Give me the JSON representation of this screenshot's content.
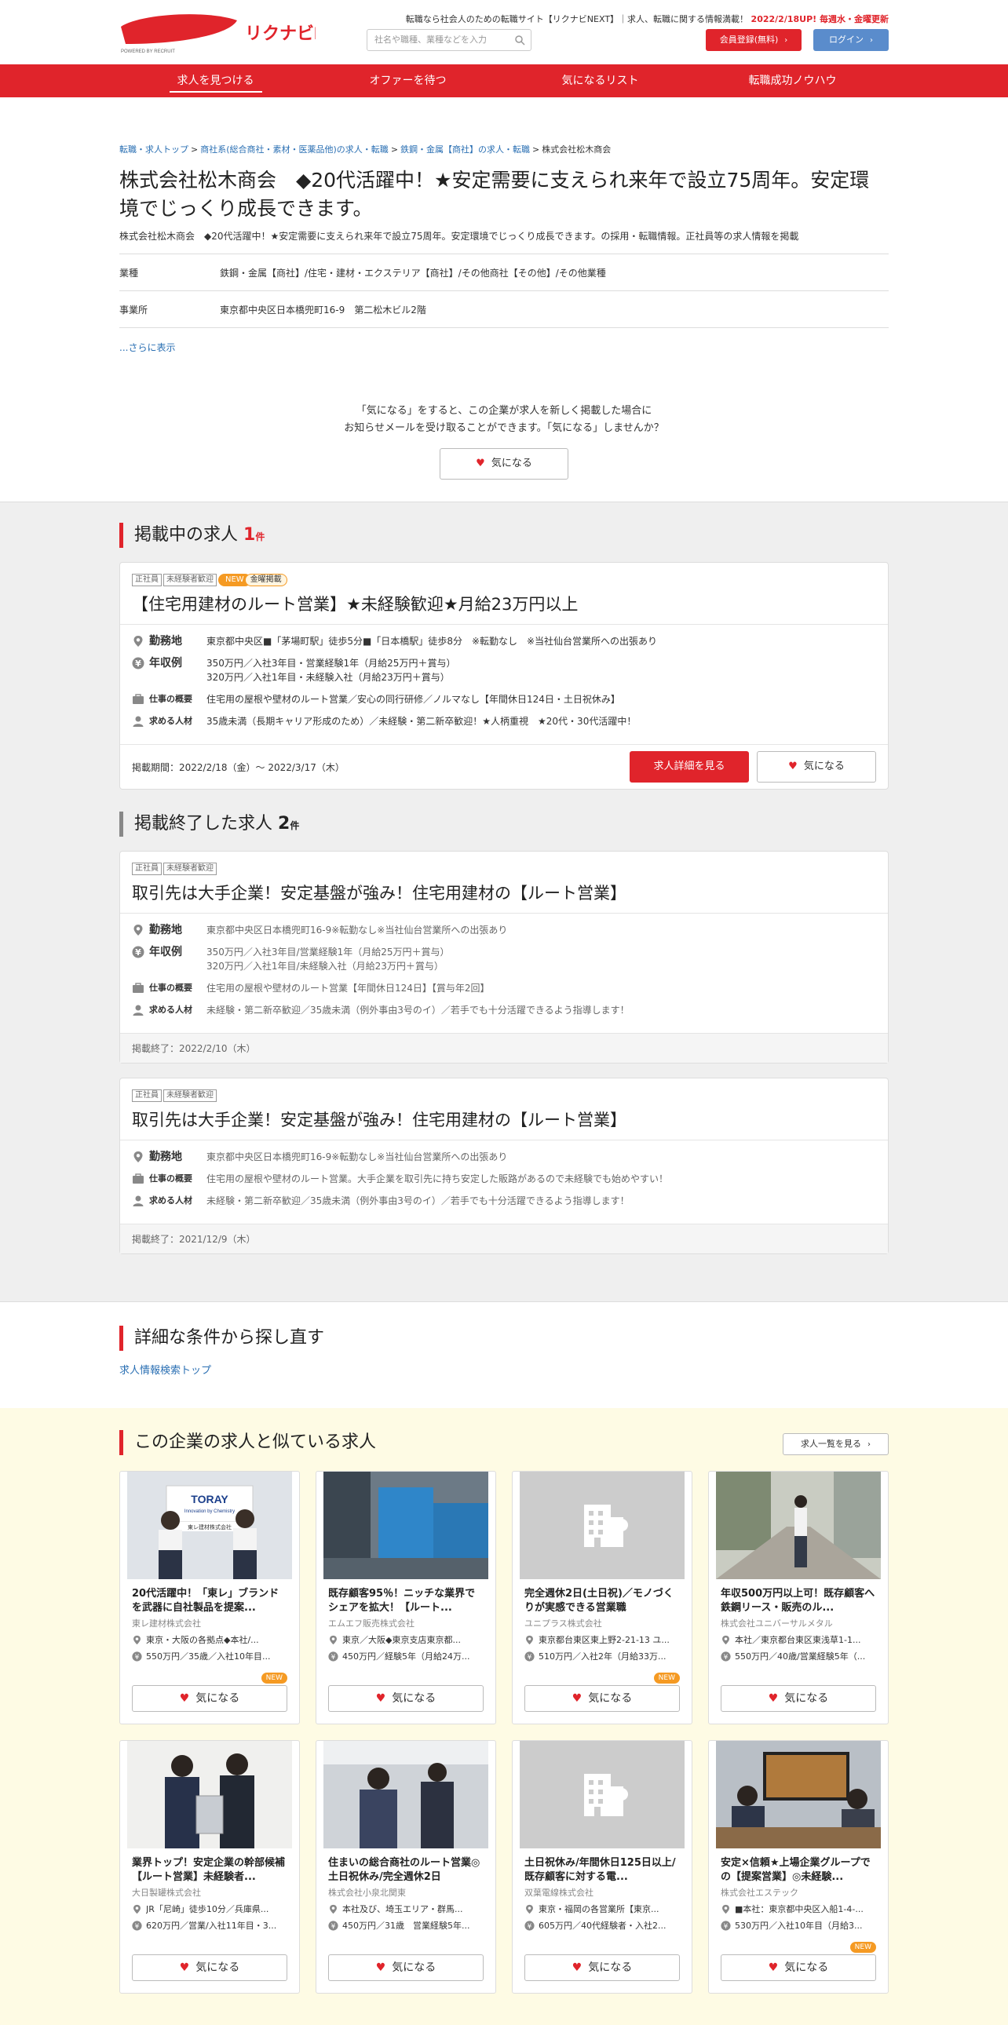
{
  "header": {
    "tagline": "転職なら社会人のための転職サイト【リクナビNEXT】｜求人、転職に関する情報満載！",
    "tagline_highlight": "2022/2/18UP! 毎週水・金曜更新",
    "logo_text": "リクナビNEXT",
    "logo_sub": "POWERED BY RECRUIT",
    "search_placeholder": "社名や職種、業種などを入力",
    "register_label": "会員登録(無料)",
    "login_label": "ログイン"
  },
  "nav": [
    "求人を見つける",
    "オファーを待つ",
    "気になるリスト",
    "転職成功ノウハウ"
  ],
  "breadcrumb": {
    "items": [
      "転職・求人トップ",
      "商社系(総合商社・素材・医薬品他)の求人・転職",
      "鉄鋼・金属【商社】の求人・転職"
    ],
    "current": "株式会社松木商会"
  },
  "company": {
    "title": "株式会社松木商会　◆20代活躍中！★安定需要に支えられ来年で設立75周年。安定環境でじっくり成長できます。",
    "description": "株式会社松木商会　◆20代活躍中！★安定需要に支えられ来年で設立75周年。安定環境でじっくり成長できます。の採用・転職情報。正社員等の求人情報を掲載",
    "info": [
      {
        "key": "業種",
        "value": "鉄鋼・金属【商社】/住宅・建材・エクステリア【商社】/その他商社【その他】/その他業種"
      },
      {
        "key": "事業所",
        "value": "東京都中央区日本橋兜町16-9　第二松木ビル2階"
      }
    ],
    "more_label": "...さらに表示",
    "follow_line1": "「気になる」をすると、この企業が求人を新しく掲載した場合に",
    "follow_line2": "お知らせメールを受け取ることができます。「気になる」しませんか？",
    "follow_label": "気になる"
  },
  "active_jobs": {
    "title": "掲載中の求人",
    "count": "1",
    "unit": "件",
    "jobs": [
      {
        "tags": [
          "正社員",
          "未経験者歓迎"
        ],
        "new_tag": "NEW",
        "kin_tag": "金曜掲載",
        "title": "【住宅用建材のルート営業】★未経験歓迎★月給23万円以上",
        "location_label": "勤務地",
        "location": "東京都中央区■「茅場町駅」徒歩5分■「日本橋駅」徒歩8分　※転勤なし　※当社仙台営業所への出張あり",
        "salary_label": "年収例",
        "salary1": "350万円／入社3年目・営業経験1年（月給25万円＋賞与）",
        "salary2": "320万円／入社1年目・未経験入社（月給23万円＋賞与）",
        "work_label": "仕事の概要",
        "work": "住宅用の屋根や壁材のルート営業／安心の同行研修／ノルマなし【年間休日124日・土日祝休み】",
        "person_label": "求める人材",
        "person": "35歳未満（長期キャリア形成のため）／未経験・第二新卒歓迎！★人柄重視　★20代・30代活躍中！",
        "period": "掲載期間：2022/2/18（金）～ 2022/3/17（木）",
        "detail_label": "求人詳細を見る",
        "fav_label": "気になる"
      }
    ]
  },
  "ended_jobs": {
    "title": "掲載終了した求人",
    "count": "2",
    "unit": "件",
    "jobs": [
      {
        "tags": [
          "正社員",
          "未経験者歓迎"
        ],
        "title": "取引先は大手企業！安定基盤が強み！住宅用建材の【ルート営業】",
        "location_label": "勤務地",
        "location": "東京都中央区日本橋兜町16-9※転勤なし※当社仙台営業所への出張あり",
        "salary_label": "年収例",
        "salary1": "350万円／入社3年目/営業経験1年（月給25万円＋賞与）",
        "salary2": "320万円／入社1年目/未経験入社（月給23万円＋賞与）",
        "work_label": "仕事の概要",
        "work": "住宅用の屋根や壁材のルート営業【年間休日124日】【賞与年2回】",
        "person_label": "求める人材",
        "person": "未経験・第二新卒歓迎／35歳未満（例外事由3号のイ）／若手でも十分活躍できるよう指導します！",
        "ended": "掲載終了：2022/2/10（木）"
      },
      {
        "tags": [
          "正社員",
          "未経験者歓迎"
        ],
        "title": "取引先は大手企業！安定基盤が強み！住宅用建材の【ルート営業】",
        "location_label": "勤務地",
        "location": "東京都中央区日本橋兜町16-9※転勤なし※当社仙台営業所への出張あり",
        "work_label": "仕事の概要",
        "work": "住宅用の屋根や壁材のルート営業。大手企業を取引先に持ち安定した販路があるので未経験でも始めやすい！",
        "person_label": "求める人材",
        "person": "未経験・第二新卒歓迎／35歳未満（例外事由3号のイ）／若手でも十分活躍できるよう指導します！",
        "ended": "掲載終了：2021/12/9（木）"
      }
    ]
  },
  "search_again": {
    "title": "詳細な条件から探し直す",
    "link": "求人情報検索トップ"
  },
  "similar": {
    "title": "この企業の求人と似ている求人",
    "list_label": "求人一覧を見る",
    "fav_label": "気になる",
    "new_label": "NEW",
    "photo_sign": "TORAY",
    "photo_sign_sub": "Innovation by Chemistry",
    "photo_banner": "東レ建材株式会社",
    "cards": [
      {
        "title": "20代活躍中！「東レ」ブランドを武器に自社製品を提案...",
        "company": "東レ建材株式会社",
        "loc": "東京・大阪の各拠点◆本社/...",
        "sal": "550万円／35歳／入社10年目...",
        "new": true,
        "photo": "toray"
      },
      {
        "title": "既存顧客95％！ニッチな業界でシェアを拡大！【ルート...",
        "company": "エムエフ販売株式会社",
        "loc": "東京／大阪◆東京支店東京都...",
        "sal": "450万円／経験5年（月給24万...",
        "new": false,
        "photo": "blue"
      },
      {
        "title": "完全週休2日(土日祝)／モノづくりが実感できる営業職",
        "company": "ユニプラス株式会社",
        "loc": "東京都台東区東上野2-21-13 ユ...",
        "sal": "510万円／入社2年（月給33万...",
        "new": true,
        "photo": "none"
      },
      {
        "title": "年収500万円以上可！既存顧客へ鉄鋼リース・販売のル...",
        "company": "株式会社ユニバーサルメタル",
        "loc": "本社／東京都台東区東浅草1-1...",
        "sal": "550万円／40歳/営業経験5年（...",
        "new": false,
        "photo": "street"
      },
      {
        "title": "業界トップ！安定企業の幹部候補【ルート営業】未経験者...",
        "company": "大日製罐株式会社",
        "loc": "JR「尼崎」徒歩10分／兵庫県...",
        "sal": "620万円／営業/入社11年目・3...",
        "new": false,
        "photo": "suits"
      },
      {
        "title": "住まいの総合商社のルート営業◎土日祝休み/完全週休2日",
        "company": "株式会社小泉北関東",
        "loc": "本社及び、埼玉エリア・群馬...",
        "sal": "450万円／31歳　営業経験5年...",
        "new": false,
        "photo": "office"
      },
      {
        "title": "土日祝休み/年間休日125日以上/既存顧客に対する電...",
        "company": "双葉電線株式会社",
        "loc": "東京・福岡の各営業所【東京...",
        "sal": "605万円／40代経験者・入社2...",
        "new": false,
        "photo": "none"
      },
      {
        "title": "安定×信頼★上場企業グループでの【提案営業】◎未経験...",
        "company": "株式会社エステック",
        "loc": "■本社：東京都中央区入船1-4-...",
        "sal": "530万円／入社10年目（月給3...",
        "new": true,
        "photo": "desk"
      }
    ]
  },
  "colors": {
    "brand_red": "#e0242b",
    "login_blue": "#5a8ccc",
    "link": "#2a6fb3",
    "new_orange": "#f59a23"
  }
}
